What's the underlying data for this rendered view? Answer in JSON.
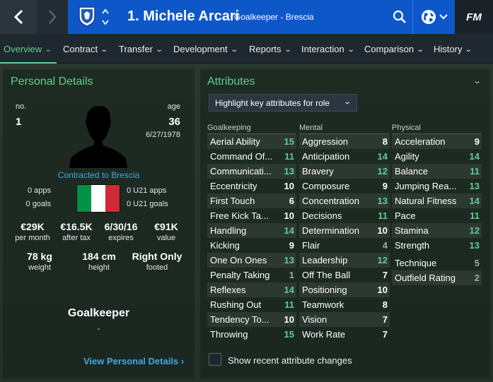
{
  "header": {
    "player_name": "1. Michele Arcari",
    "subtitle": "Goalkeeper - Brescia",
    "logo": "FM",
    "icons": [
      "back-icon",
      "forward-icon",
      "club-crest-icon",
      "updown-icon",
      "search-icon",
      "globe-icon",
      "chevron-down-icon"
    ]
  },
  "tabs": [
    {
      "label": "Overview",
      "active": true
    },
    {
      "label": "Contract"
    },
    {
      "label": "Transfer"
    },
    {
      "label": "Development"
    },
    {
      "label": "Reports"
    },
    {
      "label": "Interaction"
    },
    {
      "label": "Comparison"
    },
    {
      "label": "History"
    }
  ],
  "personal": {
    "title": "Personal Details",
    "no_label": "no.",
    "no_value": "1",
    "age_label": "age",
    "age_value": "36",
    "dob": "6/27/1978",
    "contracted": "Contracted to Brescia",
    "apps": "0 apps",
    "goals": "0 goals",
    "u21_apps": "0 U21 apps",
    "u21_goals": "0 U21 goals",
    "wage_value": "€29K",
    "wage_label": "per month",
    "aftertax_value": "€16.5K",
    "aftertax_label": "after tax",
    "expires_value": "6/30/16",
    "expires_label": "expires",
    "value_value": "€91K",
    "value_label": "value",
    "weight_value": "78 kg",
    "weight_label": "weight",
    "height_value": "184 cm",
    "height_label": "height",
    "footed_value": "Right Only",
    "footed_label": "footed",
    "position": "Goalkeeper",
    "position_sub": "-",
    "view_link": "View Personal Details",
    "flag_colors": [
      "#009246",
      "#ffffff",
      "#ce2b37"
    ]
  },
  "attributes": {
    "title": "Attributes",
    "highlight_label": "Highlight key attributes for role",
    "checkbox_label": "Show recent attribute changes",
    "columns": [
      {
        "heading": "Goalkeeping",
        "rows": [
          {
            "name": "Aerial Ability",
            "value": "15",
            "hl": true
          },
          {
            "name": "Command Of...",
            "value": "11",
            "hl": true
          },
          {
            "name": "Communicati...",
            "value": "13",
            "hl": true
          },
          {
            "name": "Eccentricity",
            "value": "10",
            "hl": false
          },
          {
            "name": "First Touch",
            "value": "6",
            "hl": false
          },
          {
            "name": "Free Kick Ta...",
            "value": "10",
            "hl": false
          },
          {
            "name": "Handling",
            "value": "14",
            "hl": true
          },
          {
            "name": "Kicking",
            "value": "9",
            "hl": false
          },
          {
            "name": "One On Ones",
            "value": "13",
            "hl": true
          },
          {
            "name": "Penalty Taking",
            "value": "1",
            "hl": false,
            "dim": true
          },
          {
            "name": "Reflexes",
            "value": "14",
            "hl": true
          },
          {
            "name": "Rushing Out",
            "value": "11",
            "hl": true
          },
          {
            "name": "Tendency To...",
            "value": "10",
            "hl": false
          },
          {
            "name": "Throwing",
            "value": "15",
            "hl": true
          }
        ]
      },
      {
        "heading": "Mental",
        "rows": [
          {
            "name": "Aggression",
            "value": "8",
            "hl": false
          },
          {
            "name": "Anticipation",
            "value": "14",
            "hl": true
          },
          {
            "name": "Bravery",
            "value": "12",
            "hl": true
          },
          {
            "name": "Composure",
            "value": "9",
            "hl": false
          },
          {
            "name": "Concentration",
            "value": "13",
            "hl": true
          },
          {
            "name": "Decisions",
            "value": "11",
            "hl": true
          },
          {
            "name": "Determination",
            "value": "10",
            "hl": false
          },
          {
            "name": "Flair",
            "value": "4",
            "hl": false,
            "dim": true
          },
          {
            "name": "Leadership",
            "value": "12",
            "hl": true
          },
          {
            "name": "Off The Ball",
            "value": "7",
            "hl": false
          },
          {
            "name": "Positioning",
            "value": "10",
            "hl": false
          },
          {
            "name": "Teamwork",
            "value": "8",
            "hl": false
          },
          {
            "name": "Vision",
            "value": "7",
            "hl": false
          },
          {
            "name": "Work Rate",
            "value": "7",
            "hl": false
          }
        ]
      },
      {
        "heading": "Physical",
        "rows": [
          {
            "name": "Acceleration",
            "value": "9",
            "hl": false
          },
          {
            "name": "Agility",
            "value": "14",
            "hl": true
          },
          {
            "name": "Balance",
            "value": "11",
            "hl": true
          },
          {
            "name": "Jumping Rea...",
            "value": "13",
            "hl": true
          },
          {
            "name": "Natural Fitness",
            "value": "14",
            "hl": true
          },
          {
            "name": "Pace",
            "value": "11",
            "hl": true
          },
          {
            "name": "Stamina",
            "value": "12",
            "hl": true
          },
          {
            "name": "Strength",
            "value": "13",
            "hl": true
          }
        ],
        "extra_rows": [
          {
            "name": "Technique",
            "value": "5",
            "hl": false,
            "dim": true
          },
          {
            "name": "Outfield Rating",
            "value": "2",
            "hl": false,
            "dim": true
          }
        ]
      }
    ]
  }
}
